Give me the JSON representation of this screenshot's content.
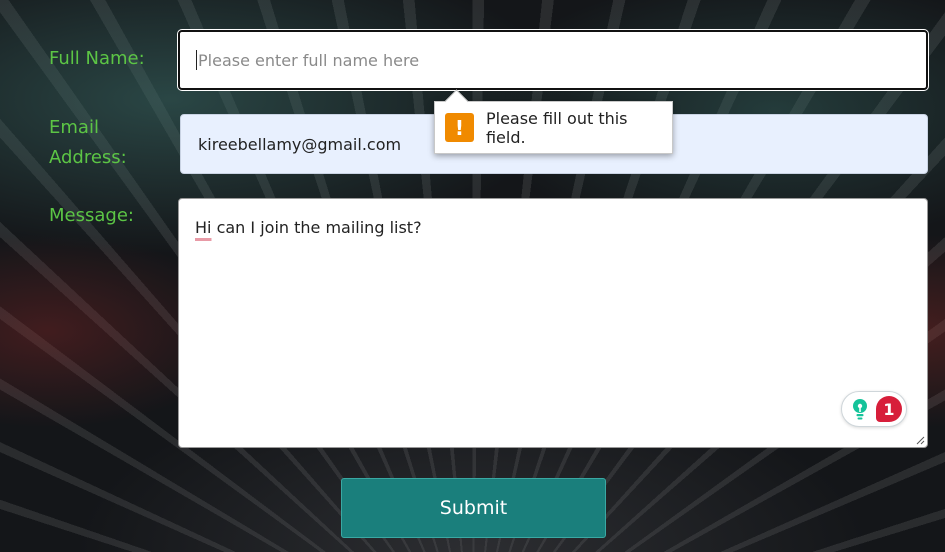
{
  "form": {
    "full_name": {
      "label": "Full Name:",
      "placeholder": "Please enter full name here",
      "value": ""
    },
    "email": {
      "label_line1": "Email",
      "label_line2": "Address:",
      "value": "kireebellamy@gmail.com"
    },
    "message": {
      "label": "Message:",
      "misspelled_word": "Hi",
      "rest_text": " can I join the mailing list?"
    },
    "submit_label": "Submit"
  },
  "validation_tooltip": {
    "icon_glyph": "!",
    "text": "Please fill out this field."
  },
  "grammar_widget": {
    "issue_count": "1",
    "badge_color": "#d71e3a"
  },
  "colors": {
    "label_green": "#5cc545",
    "submit_teal": "#1a7f7c",
    "warning_orange": "#f08a00"
  }
}
